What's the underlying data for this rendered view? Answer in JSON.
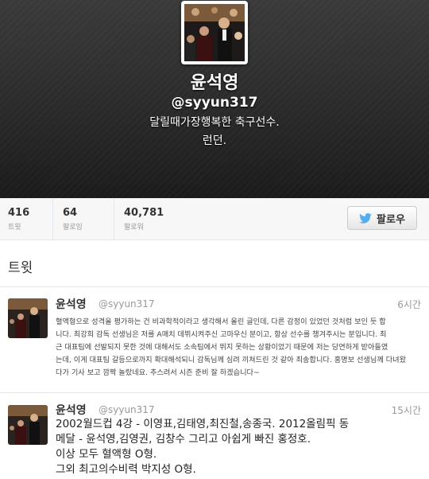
{
  "profile": {
    "name": "윤석영",
    "handle": "@syyun317",
    "bio": "달릴때가장행복한 축구선수.",
    "location": "런던."
  },
  "stats": [
    {
      "value": "416",
      "label": "트윗"
    },
    {
      "value": "64",
      "label": "팔로잉"
    },
    {
      "value": "40,781",
      "label": "팔로워"
    }
  ],
  "follow_button": {
    "label": "팔로우",
    "icon": "bird-icon"
  },
  "section": {
    "title": "트윗"
  },
  "tweets": [
    {
      "name": "윤석영",
      "handle": "@syyun317",
      "time": "6시간",
      "lines": [
        "혈액형으로 성격을 평가하는 건 비과학적이라고 생각해서 올린 글인데, 다른 감정이 있었던 것처럼 보인 듯 합",
        "니다. 최강희 감독 선생님은 저를 A매치 데뷔시켜주신 고마우신 분이고, 항상 선수를 챙겨주시는 분입니다. 최",
        "근 대표팀에 선발되지 못한 것에 대해서도 소속팀에서 뛰지 못하는 상황이었기 때문에 저는 당연하게 받아들였",
        "는데, 이게 대표팀 갈등으로까지 확대해석되니 감독님께 심려 끼쳐드린 것 같아 죄송합니다. 홍명보 선생님께 다녀왔",
        "다가 기사 보고 깜짝 놀랐네요. 추스려서 시즌 준비 잘 하겠습니다~"
      ]
    },
    {
      "name": "윤석영",
      "handle": "@syyun317",
      "time": "15시간",
      "lines": [
        "2002월드컵 4강 - 이영표,김태영,최진철,송종국. 2012올림픽 동",
        "메달 - 윤석영,김영권, 김창수 그리고 아쉽게 빠진 홍정호.",
        "이상 모두 혈액형 O형.",
        "그외 최고의수비력 박지성 O형."
      ]
    }
  ],
  "colors": {
    "twitter_blue": "#55acee",
    "hero_bg": "#2a2a2a"
  }
}
